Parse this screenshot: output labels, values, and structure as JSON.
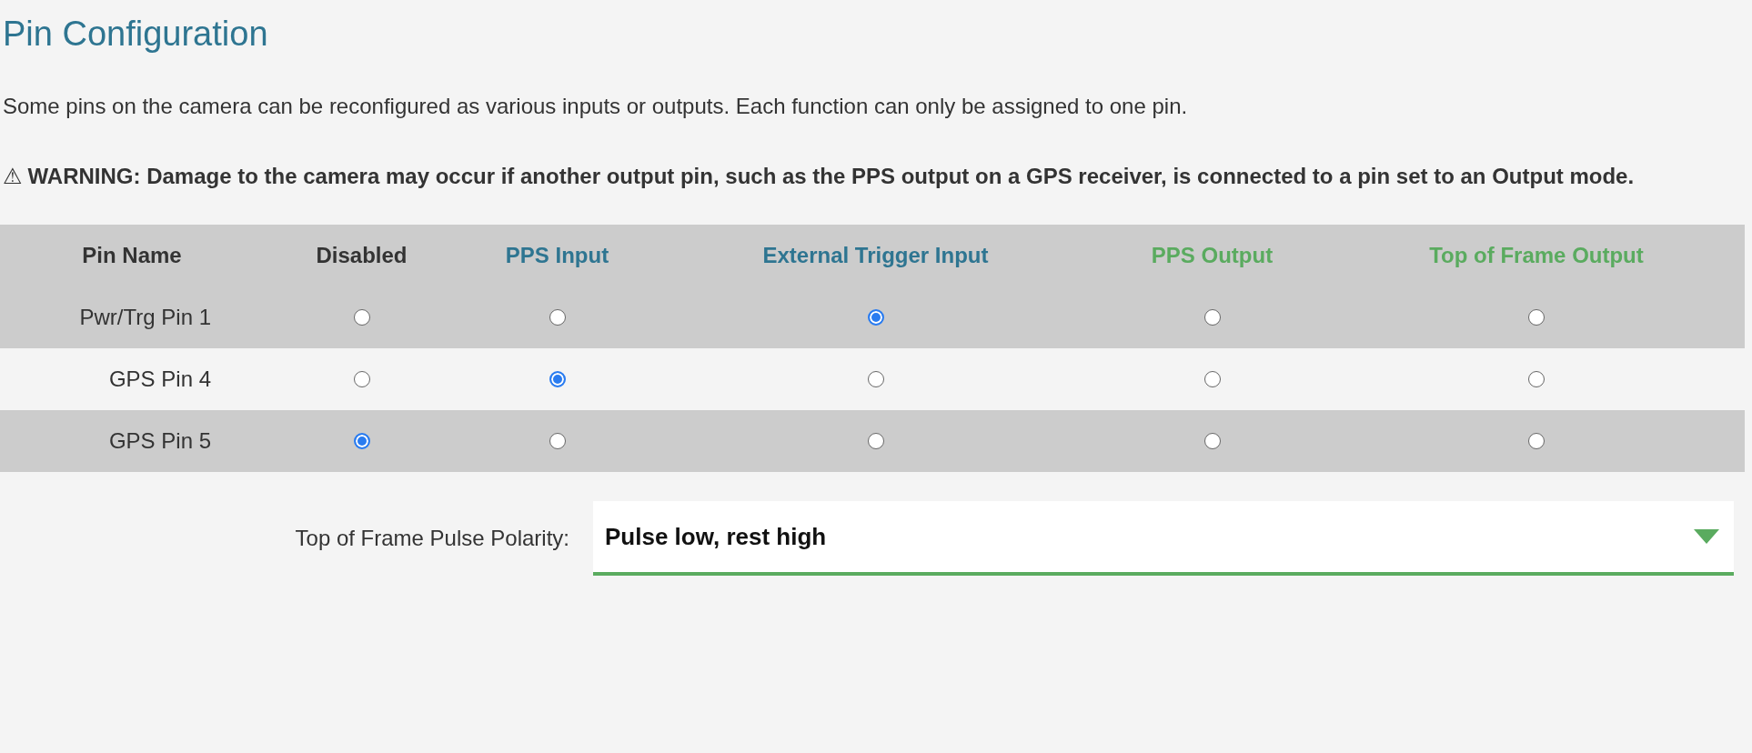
{
  "title": "Pin Configuration",
  "description": "Some pins on the camera can be reconfigured as various inputs or outputs. Each function can only be assigned to one pin.",
  "warning": {
    "icon": "⚠",
    "text": "WARNING: Damage to the camera may occur if another output pin, such as the PPS output on a GPS receiver, is connected to a pin set to an Output mode."
  },
  "table": {
    "columns": [
      {
        "label": "Pin Name",
        "color": "#333333"
      },
      {
        "label": "Disabled",
        "color": "#333333"
      },
      {
        "label": "PPS Input",
        "color": "#2e7591"
      },
      {
        "label": "External Trigger Input",
        "color": "#2e7591"
      },
      {
        "label": "PPS Output",
        "color": "#5aab5f"
      },
      {
        "label": "Top of Frame Output",
        "color": "#5aab5f"
      }
    ],
    "rows": [
      {
        "name": "Pwr/Trg Pin 1",
        "options": [
          {
            "selected": false
          },
          {
            "selected": false
          },
          {
            "selected": true
          },
          {
            "selected": false
          },
          {
            "selected": false
          }
        ]
      },
      {
        "name": "GPS Pin 4",
        "options": [
          {
            "selected": false
          },
          {
            "selected": true
          },
          {
            "selected": false
          },
          {
            "selected": false
          },
          {
            "selected": false
          }
        ]
      },
      {
        "name": "GPS Pin 5",
        "options": [
          {
            "selected": true
          },
          {
            "selected": false
          },
          {
            "selected": false
          },
          {
            "selected": false
          },
          {
            "selected": false
          }
        ]
      }
    ]
  },
  "polarity": {
    "label": "Top of Frame Pulse Polarity:",
    "value": "Pulse low, rest high"
  }
}
